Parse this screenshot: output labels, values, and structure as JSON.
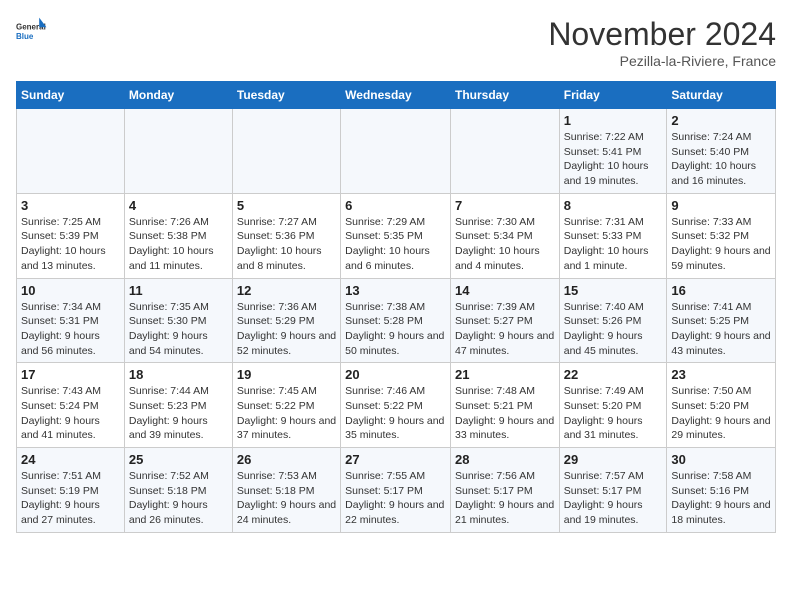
{
  "logo": {
    "line1": "General",
    "line2": "Blue"
  },
  "title": "November 2024",
  "subtitle": "Pezilla-la-Riviere, France",
  "days_header": [
    "Sunday",
    "Monday",
    "Tuesday",
    "Wednesday",
    "Thursday",
    "Friday",
    "Saturday"
  ],
  "weeks": [
    [
      {
        "day": "",
        "info": ""
      },
      {
        "day": "",
        "info": ""
      },
      {
        "day": "",
        "info": ""
      },
      {
        "day": "",
        "info": ""
      },
      {
        "day": "",
        "info": ""
      },
      {
        "day": "1",
        "info": "Sunrise: 7:22 AM\nSunset: 5:41 PM\nDaylight: 10 hours and 19 minutes."
      },
      {
        "day": "2",
        "info": "Sunrise: 7:24 AM\nSunset: 5:40 PM\nDaylight: 10 hours and 16 minutes."
      }
    ],
    [
      {
        "day": "3",
        "info": "Sunrise: 7:25 AM\nSunset: 5:39 PM\nDaylight: 10 hours and 13 minutes."
      },
      {
        "day": "4",
        "info": "Sunrise: 7:26 AM\nSunset: 5:38 PM\nDaylight: 10 hours and 11 minutes."
      },
      {
        "day": "5",
        "info": "Sunrise: 7:27 AM\nSunset: 5:36 PM\nDaylight: 10 hours and 8 minutes."
      },
      {
        "day": "6",
        "info": "Sunrise: 7:29 AM\nSunset: 5:35 PM\nDaylight: 10 hours and 6 minutes."
      },
      {
        "day": "7",
        "info": "Sunrise: 7:30 AM\nSunset: 5:34 PM\nDaylight: 10 hours and 4 minutes."
      },
      {
        "day": "8",
        "info": "Sunrise: 7:31 AM\nSunset: 5:33 PM\nDaylight: 10 hours and 1 minute."
      },
      {
        "day": "9",
        "info": "Sunrise: 7:33 AM\nSunset: 5:32 PM\nDaylight: 9 hours and 59 minutes."
      }
    ],
    [
      {
        "day": "10",
        "info": "Sunrise: 7:34 AM\nSunset: 5:31 PM\nDaylight: 9 hours and 56 minutes."
      },
      {
        "day": "11",
        "info": "Sunrise: 7:35 AM\nSunset: 5:30 PM\nDaylight: 9 hours and 54 minutes."
      },
      {
        "day": "12",
        "info": "Sunrise: 7:36 AM\nSunset: 5:29 PM\nDaylight: 9 hours and 52 minutes."
      },
      {
        "day": "13",
        "info": "Sunrise: 7:38 AM\nSunset: 5:28 PM\nDaylight: 9 hours and 50 minutes."
      },
      {
        "day": "14",
        "info": "Sunrise: 7:39 AM\nSunset: 5:27 PM\nDaylight: 9 hours and 47 minutes."
      },
      {
        "day": "15",
        "info": "Sunrise: 7:40 AM\nSunset: 5:26 PM\nDaylight: 9 hours and 45 minutes."
      },
      {
        "day": "16",
        "info": "Sunrise: 7:41 AM\nSunset: 5:25 PM\nDaylight: 9 hours and 43 minutes."
      }
    ],
    [
      {
        "day": "17",
        "info": "Sunrise: 7:43 AM\nSunset: 5:24 PM\nDaylight: 9 hours and 41 minutes."
      },
      {
        "day": "18",
        "info": "Sunrise: 7:44 AM\nSunset: 5:23 PM\nDaylight: 9 hours and 39 minutes."
      },
      {
        "day": "19",
        "info": "Sunrise: 7:45 AM\nSunset: 5:22 PM\nDaylight: 9 hours and 37 minutes."
      },
      {
        "day": "20",
        "info": "Sunrise: 7:46 AM\nSunset: 5:22 PM\nDaylight: 9 hours and 35 minutes."
      },
      {
        "day": "21",
        "info": "Sunrise: 7:48 AM\nSunset: 5:21 PM\nDaylight: 9 hours and 33 minutes."
      },
      {
        "day": "22",
        "info": "Sunrise: 7:49 AM\nSunset: 5:20 PM\nDaylight: 9 hours and 31 minutes."
      },
      {
        "day": "23",
        "info": "Sunrise: 7:50 AM\nSunset: 5:20 PM\nDaylight: 9 hours and 29 minutes."
      }
    ],
    [
      {
        "day": "24",
        "info": "Sunrise: 7:51 AM\nSunset: 5:19 PM\nDaylight: 9 hours and 27 minutes."
      },
      {
        "day": "25",
        "info": "Sunrise: 7:52 AM\nSunset: 5:18 PM\nDaylight: 9 hours and 26 minutes."
      },
      {
        "day": "26",
        "info": "Sunrise: 7:53 AM\nSunset: 5:18 PM\nDaylight: 9 hours and 24 minutes."
      },
      {
        "day": "27",
        "info": "Sunrise: 7:55 AM\nSunset: 5:17 PM\nDaylight: 9 hours and 22 minutes."
      },
      {
        "day": "28",
        "info": "Sunrise: 7:56 AM\nSunset: 5:17 PM\nDaylight: 9 hours and 21 minutes."
      },
      {
        "day": "29",
        "info": "Sunrise: 7:57 AM\nSunset: 5:17 PM\nDaylight: 9 hours and 19 minutes."
      },
      {
        "day": "30",
        "info": "Sunrise: 7:58 AM\nSunset: 5:16 PM\nDaylight: 9 hours and 18 minutes."
      }
    ]
  ]
}
